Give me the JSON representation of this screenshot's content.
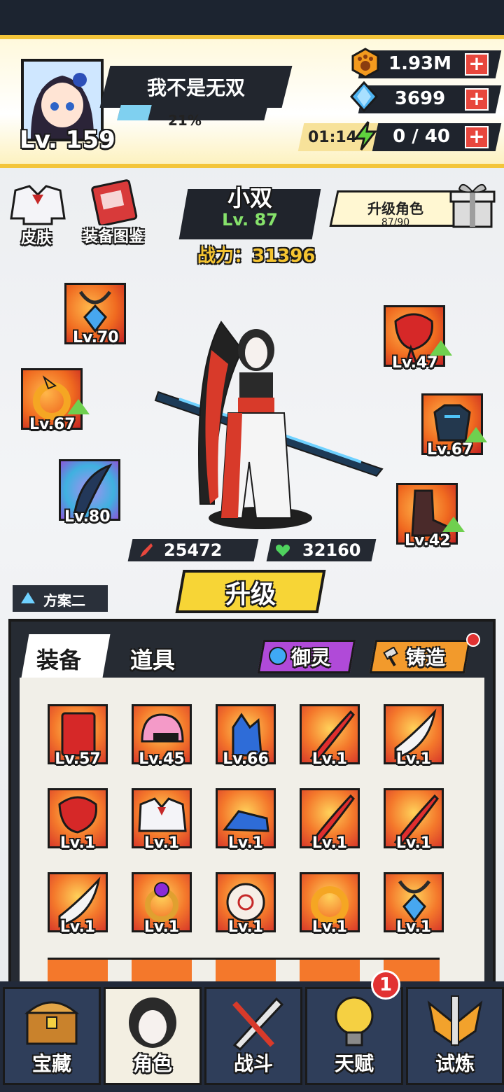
{
  "player": {
    "name": "我不是无双",
    "level": "Lv. 159",
    "xp_percent": "21%",
    "xp_fraction": 0.21
  },
  "resources": [
    {
      "icon": "paw-coin-icon",
      "value": "1.93M"
    },
    {
      "icon": "blue-gem-icon",
      "value": "3699"
    },
    {
      "icon": "lightning-icon",
      "value": "0 / 40",
      "timer": "01:14"
    }
  ],
  "top_icons": {
    "skin": "皮肤",
    "codex": "装备图鉴"
  },
  "character": {
    "name": "小双",
    "level": "Lv. 87",
    "power": "战力：31396",
    "attack": "25472",
    "hp": "32160"
  },
  "upgrade_character": {
    "title": "升级角色",
    "progress": "87/90"
  },
  "equip_slots": [
    {
      "icon": "amulet-icon",
      "level": "Lv.70",
      "upgradable": false
    },
    {
      "icon": "dragon-ring-icon",
      "level": "Lv.67",
      "upgradable": true
    },
    {
      "icon": "crystal-blade-icon",
      "level": "Lv.80",
      "upgradable": false
    },
    {
      "icon": "red-scarf-icon",
      "level": "Lv.47",
      "upgradable": true
    },
    {
      "icon": "armor-icon",
      "level": "Lv.67",
      "upgradable": true
    },
    {
      "icon": "boot-icon",
      "level": "Lv.42",
      "upgradable": true
    }
  ],
  "upgrade_button": "升级",
  "scheme": "方案二",
  "tabs": {
    "equipment": "装备",
    "items": "道具",
    "yuling": "御灵",
    "forge": "铸造"
  },
  "inventory": [
    {
      "icon": "book-icon",
      "level": "Lv.57"
    },
    {
      "icon": "helmet-icon",
      "level": "Lv.45"
    },
    {
      "icon": "glove-icon",
      "level": "Lv.66"
    },
    {
      "icon": "sword-icon",
      "level": "Lv.1"
    },
    {
      "icon": "blade-icon",
      "level": "Lv.1"
    },
    {
      "icon": "scarf-icon",
      "level": "Lv.1"
    },
    {
      "icon": "sailor-top-icon",
      "level": "Lv.1"
    },
    {
      "icon": "shoe-icon",
      "level": "Lv.1"
    },
    {
      "icon": "sword-icon",
      "level": "Lv.1"
    },
    {
      "icon": "sword-icon",
      "level": "Lv.1"
    },
    {
      "icon": "blade-icon",
      "level": "Lv.1"
    },
    {
      "icon": "ring-icon",
      "level": "Lv.1"
    },
    {
      "icon": "bead-icon",
      "level": "Lv.1"
    },
    {
      "icon": "dragon-ring-icon",
      "level": "Lv.1"
    },
    {
      "icon": "amulet-icon",
      "level": "Lv.1"
    }
  ],
  "nav": [
    {
      "icon": "treasure-chest-icon",
      "label": "宝藏"
    },
    {
      "icon": "character-icon",
      "label": "角色"
    },
    {
      "icon": "battle-icon",
      "label": "战斗"
    },
    {
      "icon": "lightbulb-icon",
      "label": "天赋",
      "badge": "1"
    },
    {
      "icon": "trial-icon",
      "label": "试炼"
    }
  ]
}
